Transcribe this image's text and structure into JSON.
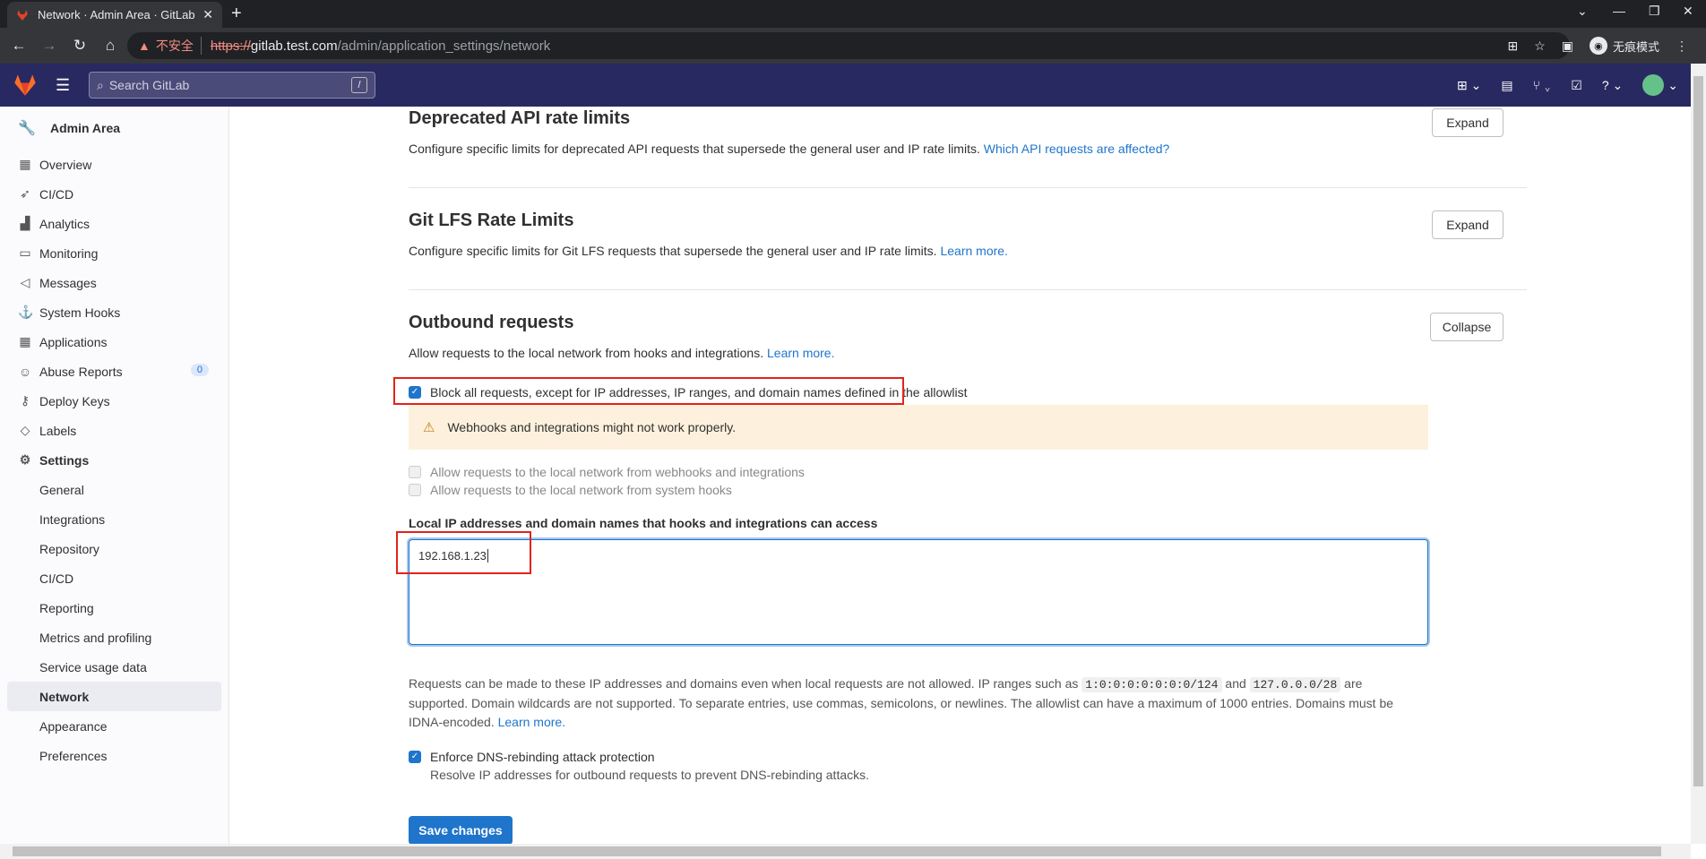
{
  "browser": {
    "tab_title": "Network · Admin Area · GitLab",
    "tab_close": "✕",
    "new_tab": "+",
    "insecure_label": "不安全",
    "url_scheme": "https://",
    "url_host": "gitlab.test.com",
    "url_path": "/admin/application_settings/network",
    "incognito_label": "无痕模式"
  },
  "header": {
    "search_placeholder": "Search GitLab",
    "search_shortcut": "/"
  },
  "sidebar": {
    "title": "Admin Area",
    "items": [
      {
        "label": "Overview",
        "icon": "overview-icon"
      },
      {
        "label": "CI/CD",
        "icon": "rocket-icon"
      },
      {
        "label": "Analytics",
        "icon": "chart-icon"
      },
      {
        "label": "Monitoring",
        "icon": "monitor-icon"
      },
      {
        "label": "Messages",
        "icon": "bullhorn-icon"
      },
      {
        "label": "System Hooks",
        "icon": "anchor-icon"
      },
      {
        "label": "Applications",
        "icon": "applications-icon"
      },
      {
        "label": "Abuse Reports",
        "icon": "abuse-icon",
        "badge": "0"
      },
      {
        "label": "Deploy Keys",
        "icon": "key-icon"
      },
      {
        "label": "Labels",
        "icon": "label-icon"
      },
      {
        "label": "Settings",
        "icon": "settings-icon"
      }
    ],
    "settings_sub": [
      "General",
      "Integrations",
      "Repository",
      "CI/CD",
      "Reporting",
      "Metrics and profiling",
      "Service usage data",
      "Network",
      "Appearance",
      "Preferences"
    ]
  },
  "sections": {
    "deprecated": {
      "title": "Deprecated API rate limits",
      "desc": "Configure specific limits for deprecated API requests that supersede the general user and IP rate limits.",
      "link": "Which API requests are affected?",
      "button": "Expand"
    },
    "lfs": {
      "title": "Git LFS Rate Limits",
      "desc": "Configure specific limits for Git LFS requests that supersede the general user and IP rate limits.",
      "link": "Learn more.",
      "button": "Expand"
    },
    "outbound": {
      "title": "Outbound requests",
      "desc": "Allow requests to the local network from hooks and integrations.",
      "link": "Learn more.",
      "button": "Collapse",
      "block_all": "Block all requests, except for IP addresses, IP ranges, and domain names defined in the allowlist",
      "warning": "Webhooks and integrations might not work properly.",
      "allow_webhooks": "Allow requests to the local network from webhooks and integrations",
      "allow_system_hooks": "Allow requests to the local network from system hooks",
      "allowlist_label": "Local IP addresses and domain names that hooks and integrations can access",
      "allowlist_value": "192.168.1.23",
      "help_1": "Requests can be made to these IP addresses and domains even when local requests are not allowed. IP ranges such as",
      "help_code_1": "1:0:0:0:0:0:0:0/124",
      "help_and": "and",
      "help_code_2": "127.0.0.0/28",
      "help_2": "are supported. Domain wildcards are not supported. To separate entries, use commas, semicolons, or newlines. The allowlist can have a maximum of 1000 entries. Domains must be IDNA-encoded.",
      "help_link": "Learn more.",
      "dns_label": "Enforce DNS-rebinding attack protection",
      "dns_help": "Resolve IP addresses for outbound requests to prevent DNS-rebinding attacks.",
      "save": "Save changes"
    }
  },
  "colors": {
    "header_bg": "#292961",
    "primary": "#1f75cb",
    "warning_bg": "#fdf1dd",
    "highlight_box": "#e2231a"
  }
}
